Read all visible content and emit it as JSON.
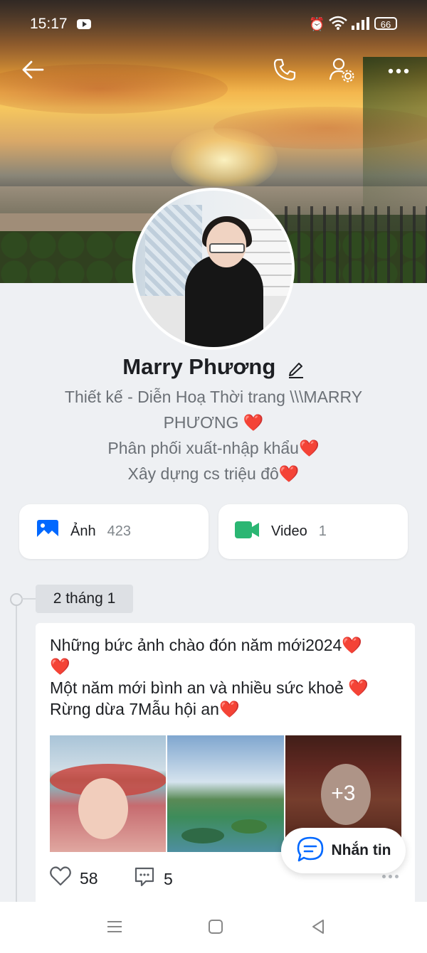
{
  "status_bar": {
    "time": "15:17",
    "battery": "66"
  },
  "profile": {
    "name": "Marry Phương",
    "bio_lines": [
      "Thiết kế - Diễn Hoạ Thời trang \\\\\\MARRY",
      "PHƯƠNG ❤️",
      "Phân phối xuất-nhập khẩu❤️",
      "Xây dựng cs triệu đô❤️"
    ]
  },
  "media": {
    "photos": {
      "label": "Ảnh",
      "count": "423"
    },
    "videos": {
      "label": "Video",
      "count": "1"
    }
  },
  "timeline": {
    "date_label": "2 tháng 1"
  },
  "post": {
    "text_lines": [
      "Những bức ảnh chào đón năm mới2024❤️",
      "❤️",
      "Một năm mới bình an và nhiều sức khoẻ ❤️",
      "Rừng dừa 7Mẫu hội an❤️"
    ],
    "more_photos": "+3",
    "likes": "58",
    "comments": "5"
  },
  "message_button": {
    "label": "Nhắn tin"
  },
  "colors": {
    "accent_blue": "#0068ff",
    "video_green": "#2bb673",
    "background": "#eef0f3"
  },
  "icons": [
    "back-arrow-icon",
    "phone-icon",
    "user-settings-icon",
    "more-icon",
    "edit-pencil-icon",
    "image-icon",
    "video-camera-icon",
    "heart-icon",
    "comment-icon",
    "chat-bubble-icon",
    "menu-icon",
    "home-square-icon",
    "back-triangle-icon"
  ]
}
